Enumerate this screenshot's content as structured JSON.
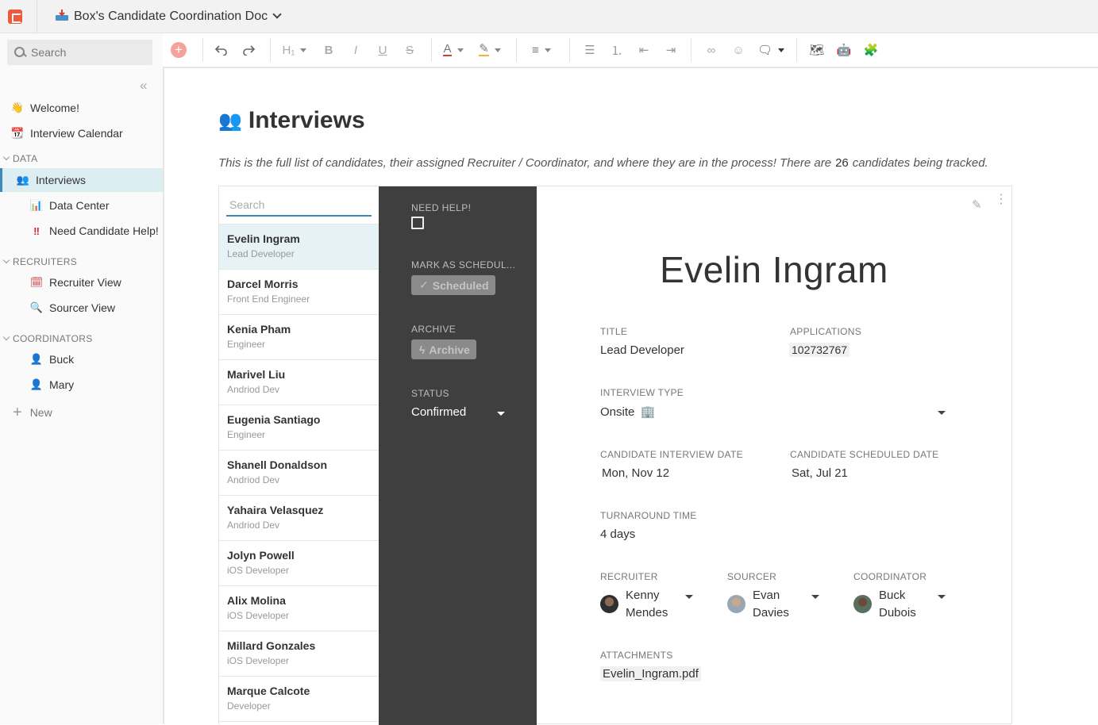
{
  "doc": {
    "title": "Box's Candidate Coordination Doc",
    "icon": "inbox-tray-icon"
  },
  "sidebar": {
    "search_placeholder": "Search",
    "top_items": [
      {
        "label": "Welcome!",
        "icon": "waving-hand-icon"
      },
      {
        "label": "Interview Calendar",
        "icon": "calendar-icon"
      }
    ],
    "sections": [
      {
        "label": "DATA",
        "items": [
          {
            "label": "Interviews",
            "icon": "people-icon",
            "active": true
          },
          {
            "label": "Data Center",
            "icon": "bar-chart-icon"
          },
          {
            "label": "Need Candidate Help!",
            "icon": "double-exclamation-icon"
          }
        ]
      },
      {
        "label": "RECRUITERS",
        "items": [
          {
            "label": "Recruiter View",
            "icon": "calendar-icon"
          },
          {
            "label": "Sourcer View",
            "icon": "magnifier-icon"
          }
        ]
      },
      {
        "label": "COORDINATORS",
        "items": [
          {
            "label": "Buck",
            "icon": "person-icon"
          },
          {
            "label": "Mary",
            "icon": "person-icon"
          }
        ]
      }
    ],
    "new_label": "New"
  },
  "page": {
    "title": "Interviews",
    "intro_before": "This is the full list of candidates, their assigned Recruiter / Coordinator, and where they are in the process! There are",
    "count": "26",
    "intro_after": "candidates being tracked."
  },
  "list": {
    "search_placeholder": "Search",
    "rows": [
      {
        "name": "Evelin Ingram",
        "role": "Lead Developer"
      },
      {
        "name": "Darcel Morris",
        "role": "Front End Engineer"
      },
      {
        "name": "Kenia Pham",
        "role": "Engineer"
      },
      {
        "name": "Marivel Liu",
        "role": "Andriod Dev"
      },
      {
        "name": "Eugenia Santiago",
        "role": "Engineer"
      },
      {
        "name": "Shanell Donaldson",
        "role": "Andriod Dev"
      },
      {
        "name": "Yahaira Velasquez",
        "role": "Andriod Dev"
      },
      {
        "name": "Jolyn Powell",
        "role": "iOS Developer"
      },
      {
        "name": "Alix Molina",
        "role": "iOS Developer"
      },
      {
        "name": "Millard Gonzales",
        "role": "iOS Developer"
      },
      {
        "name": "Marque Calcote",
        "role": "Developer"
      }
    ]
  },
  "panel": {
    "need_help_label": "NEED HELP!",
    "schedule_label": "MARK AS SCHEDUL...",
    "schedule_button": "Scheduled",
    "archive_label": "ARCHIVE",
    "archive_button": "Archive",
    "status_label": "STATUS",
    "status_value": "Confirmed"
  },
  "detail": {
    "name": "Evelin Ingram",
    "title_label": "TITLE",
    "title_value": "Lead Developer",
    "applications_label": "APPLICATIONS",
    "applications_value": "102732767",
    "interview_type_label": "INTERVIEW TYPE",
    "interview_type_value": "Onsite",
    "interview_date_label": "CANDIDATE INTERVIEW DATE",
    "interview_date_value": "Mon, Nov 12",
    "scheduled_date_label": "CANDIDATE SCHEDULED DATE",
    "scheduled_date_value": "Sat, Jul 21",
    "turnaround_label": "TURNAROUND TIME",
    "turnaround_value": "4 days",
    "recruiter_label": "RECRUITER",
    "recruiter_first": "Kenny",
    "recruiter_last": "Mendes",
    "sourcer_label": "SOURCER",
    "sourcer_first": "Evan",
    "sourcer_last": "Davies",
    "coordinator_label": "COORDINATOR",
    "coordinator_first": "Buck",
    "coordinator_last": "Dubois",
    "attachments_label": "ATTACHMENTS",
    "attachment_file": "Evelin_Ingram.pdf"
  },
  "colors": {
    "accent": "#3d8ab8",
    "brand": "#ee5a3c",
    "dark_panel": "#3f3f3f",
    "active_row": "#e6f2f6"
  }
}
